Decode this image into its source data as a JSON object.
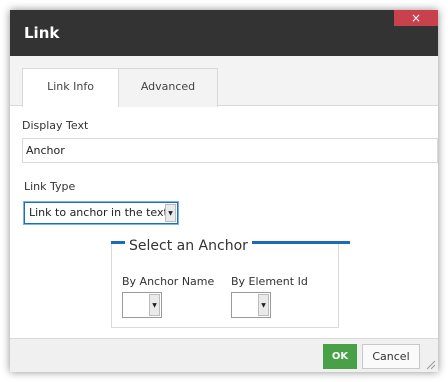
{
  "dialog": {
    "title": "Link",
    "close_symbol": "×",
    "tabs": [
      {
        "label": "Link Info",
        "active": true
      },
      {
        "label": "Advanced",
        "active": false
      }
    ],
    "display_text": {
      "label": "Display Text",
      "value": "Anchor"
    },
    "link_type": {
      "label": "Link Type",
      "value": "Link to anchor in the text"
    },
    "anchor_section": {
      "legend": "Select an Anchor",
      "by_name": {
        "label": "By Anchor Name",
        "value": ""
      },
      "by_id": {
        "label": "By Element Id",
        "value": ""
      }
    },
    "buttons": {
      "ok": "OK",
      "cancel": "Cancel"
    }
  },
  "icons": {
    "close": "close-icon",
    "dropdown": "chevron-down-icon",
    "resize": "resize-grip-icon"
  },
  "colors": {
    "titlebar": "#333333",
    "close_button": "#c9414d",
    "accent_blue": "#1b6bb5",
    "ok_green": "#48a047"
  }
}
